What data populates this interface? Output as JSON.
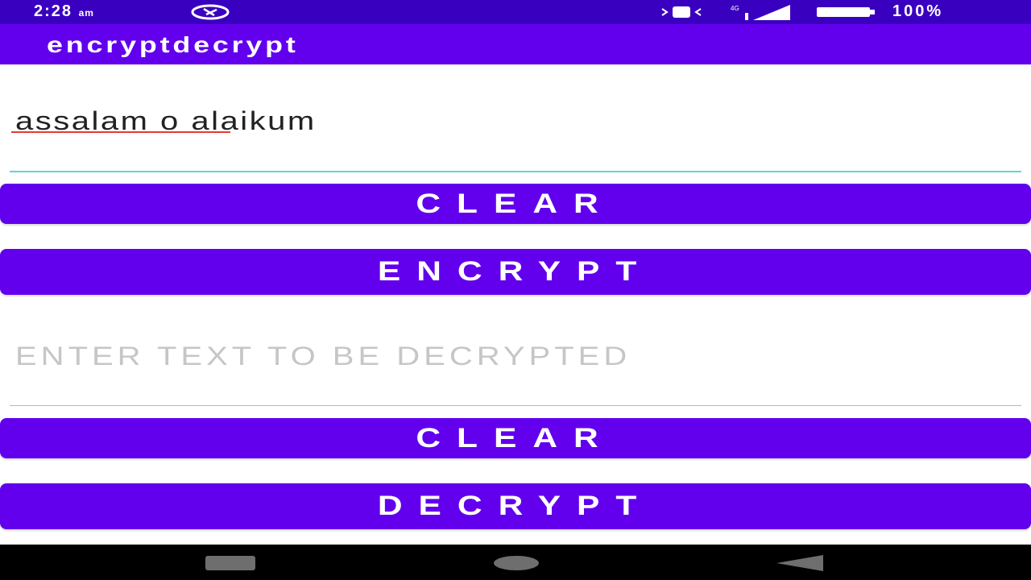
{
  "status_bar": {
    "time": "2:28",
    "time_suffix": "am",
    "battery": "100%",
    "icons": [
      "sync-icon",
      "vibrate-icon",
      "signal-icon",
      "battery-icon"
    ]
  },
  "app_bar": {
    "title": "encryptdecrypt"
  },
  "encrypt_input": {
    "value": "assalam o alaikum",
    "placeholder": ""
  },
  "buttons": {
    "clear_top": "CLEAR",
    "encrypt": "ENCRYPT",
    "clear_bottom": "CLEAR",
    "decrypt": "DECRYPT"
  },
  "decrypt_input": {
    "value": "",
    "placeholder": "ENTER TEXT TO BE DECRYPTED"
  },
  "nav_bar": {
    "icons": [
      "back-icon",
      "home-icon",
      "recent-apps-icon"
    ]
  },
  "colors": {
    "status_bar": "#3a00c0",
    "primary": "#6200ee",
    "focus_underline": "#5ed6d2",
    "spellcheck": "#e53935",
    "nav_bar": "#000000"
  }
}
